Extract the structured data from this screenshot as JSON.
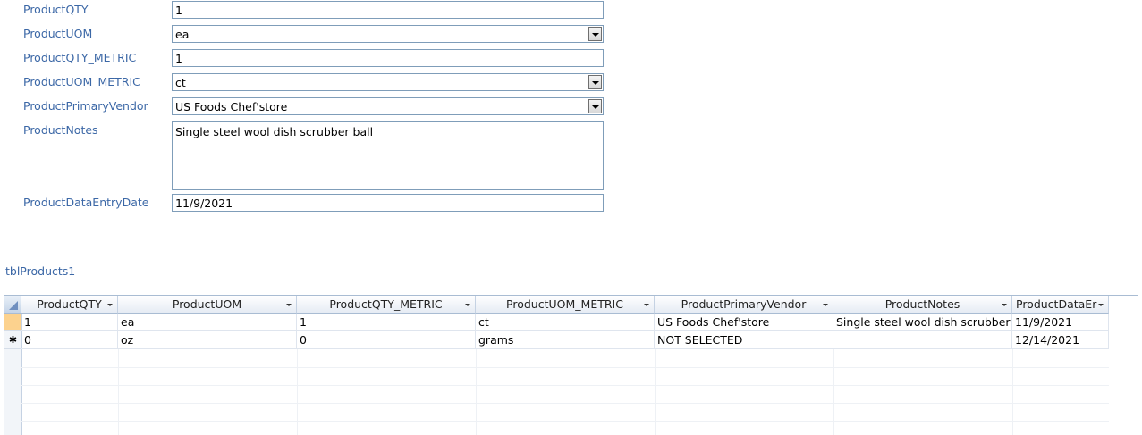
{
  "form": {
    "fields": [
      {
        "label": "ProductQTY",
        "value": "1"
      },
      {
        "label": "ProductUOM",
        "value": "ea"
      },
      {
        "label": "ProductQTY_METRIC",
        "value": "1"
      },
      {
        "label": "ProductUOM_METRIC",
        "value": "ct"
      },
      {
        "label": "ProductPrimaryVendor",
        "value": "US Foods Chef'store"
      },
      {
        "label": "ProductNotes",
        "value": "Single steel wool dish scrubber ball"
      },
      {
        "label": "ProductDataEntryDate",
        "value": "11/9/2021"
      }
    ]
  },
  "subform": {
    "title": "tblProducts1",
    "columns": [
      "ProductQTY",
      "ProductUOM",
      "ProductQTY_METRIC",
      "ProductUOM_METRIC",
      "ProductPrimaryVendor",
      "ProductNotes",
      "ProductDataEr"
    ],
    "rows": [
      [
        "1",
        "ea",
        "1",
        "ct",
        "US Foods Chef'store",
        "Single steel wool dish scrubber",
        "11/9/2021"
      ],
      [
        "0",
        "oz",
        "0",
        "grams",
        "NOT SELECTED",
        "",
        "12/14/2021"
      ]
    ],
    "new_record_marker": "✱",
    "colors": {
      "label": "#3b67a6",
      "selected_row": "#fcd28e"
    }
  }
}
